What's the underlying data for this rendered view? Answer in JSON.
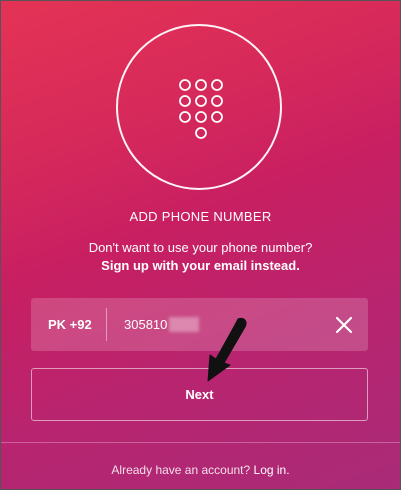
{
  "header": {
    "emblem_icon": "keypad-icon",
    "title": "ADD PHONE NUMBER",
    "subtitle_line1": "Don't want to use your phone number?",
    "subtitle_link": "Sign up with your email instead."
  },
  "phone_input": {
    "country_code": "PK +92",
    "value": "305810",
    "clear_icon": "close-icon"
  },
  "next_button": {
    "label": "Next"
  },
  "footer": {
    "prompt": "Already have an account?",
    "login_label": "Log in."
  },
  "colors": {
    "gradient_start": "#e43355",
    "gradient_end": "#a92b78"
  }
}
